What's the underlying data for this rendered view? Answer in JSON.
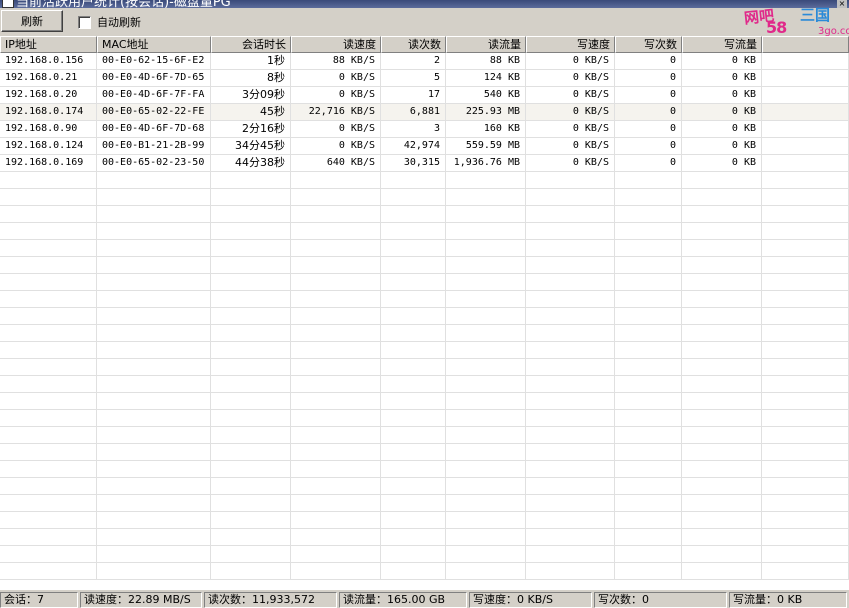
{
  "window": {
    "title": "当前活跃用户统计(按会话)-磁盘量PG"
  },
  "toolbar": {
    "refresh_label": "刷新",
    "auto_refresh_label": "自动刷新",
    "auto_refresh_checked": false
  },
  "watermark": {
    "part_a": "网吧",
    "part_b": "58",
    "part_c": "三国",
    "part_d": "3go.com"
  },
  "table": {
    "columns": [
      "IP地址",
      "MAC地址",
      "会话时长",
      "读速度",
      "读次数",
      "读流量",
      "写速度",
      "写次数",
      "写流量",
      ""
    ],
    "rows": [
      [
        "192.168.0.156",
        "00-E0-62-15-6F-E2",
        "1秒",
        "88 KB/S",
        "2",
        "88 KB",
        "0 KB/S",
        "0",
        "0 KB"
      ],
      [
        "192.168.0.21",
        "00-E0-4D-6F-7D-65",
        "8秒",
        "0 KB/S",
        "5",
        "124 KB",
        "0 KB/S",
        "0",
        "0 KB"
      ],
      [
        "192.168.0.20",
        "00-E0-4D-6F-7F-FA",
        "3分09秒",
        "0 KB/S",
        "17",
        "540 KB",
        "0 KB/S",
        "0",
        "0 KB"
      ],
      [
        "192.168.0.174",
        "00-E0-65-02-22-FE",
        "45秒",
        "22,716 KB/S",
        "6,881",
        "225.93 MB",
        "0 KB/S",
        "0",
        "0 KB"
      ],
      [
        "192.168.0.90",
        "00-E0-4D-6F-7D-68",
        "2分16秒",
        "0 KB/S",
        "3",
        "160 KB",
        "0 KB/S",
        "0",
        "0 KB"
      ],
      [
        "192.168.0.124",
        "00-E0-B1-21-2B-99",
        "34分45秒",
        "0 KB/S",
        "42,974",
        "559.59 MB",
        "0 KB/S",
        "0",
        "0 KB"
      ],
      [
        "192.168.0.169",
        "00-E0-65-02-23-50",
        "44分38秒",
        "640 KB/S",
        "30,315",
        "1,936.76 MB",
        "0 KB/S",
        "0",
        "0 KB"
      ]
    ]
  },
  "status": {
    "sessions": "会话：7",
    "read_speed": "读速度：22.89 MB/S",
    "read_count": "读次数：11,933,572",
    "read_traffic": "读流量：165.00 GB",
    "write_speed": "写速度：0 KB/S",
    "write_count": "写次数：0",
    "write_traffic": "写流量：0 KB"
  }
}
